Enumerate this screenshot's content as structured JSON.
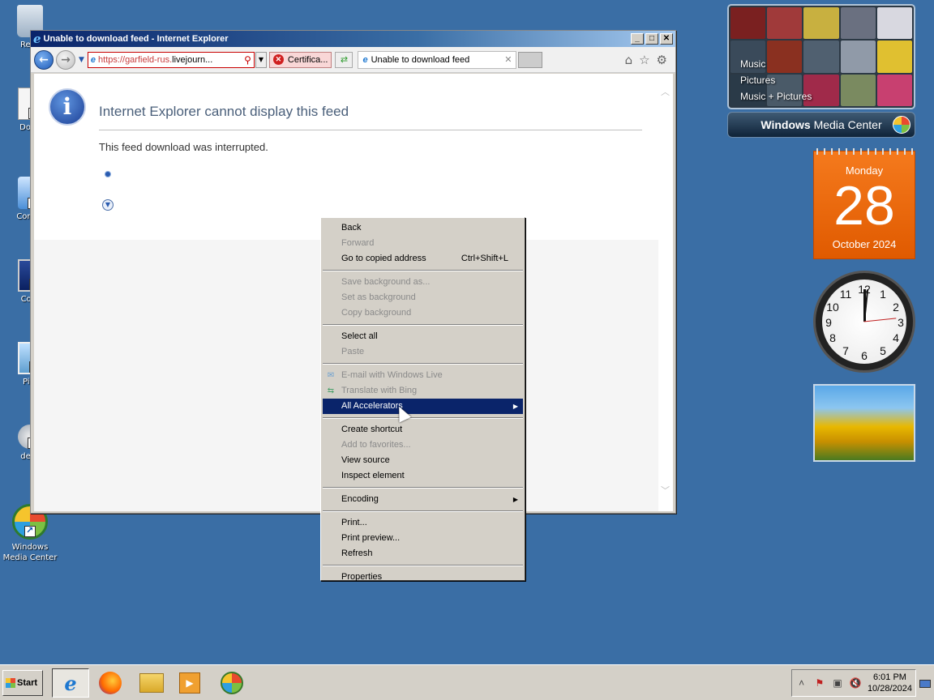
{
  "desktop": {
    "icons": [
      {
        "label": "Recy"
      },
      {
        "label": "Docu"
      },
      {
        "label": "Contro"
      },
      {
        "label": "Com"
      },
      {
        "label": "Pict"
      },
      {
        "label": "desk"
      },
      {
        "label": "Windows Media Center"
      }
    ]
  },
  "ie": {
    "title": "Unable to download feed - Internet Explorer",
    "address_domain": "https://garfield-rus.",
    "address_host": "livejourn...",
    "cert_label": "Certifica...",
    "tab_label": "Unable to download feed",
    "error_title": "Internet Explorer cannot display this feed",
    "error_message": "This feed download was interrupted."
  },
  "context_menu": {
    "items": [
      {
        "label": "Back",
        "disabled": false
      },
      {
        "label": "Forward",
        "disabled": true
      },
      {
        "label": "Go to copied address",
        "shortcut": "Ctrl+Shift+L",
        "disabled": false
      },
      {
        "label": "Save background as...",
        "disabled": true
      },
      {
        "label": "Set as background",
        "disabled": true
      },
      {
        "label": "Copy background",
        "disabled": true
      },
      {
        "label": "Select all",
        "disabled": false
      },
      {
        "label": "Paste",
        "disabled": true
      },
      {
        "label": "E-mail with Windows Live",
        "disabled": true
      },
      {
        "label": "Translate with Bing",
        "disabled": true
      },
      {
        "label": "All Accelerators",
        "disabled": false,
        "highlighted": true
      },
      {
        "label": "Create shortcut",
        "disabled": false
      },
      {
        "label": "Add to favorites...",
        "disabled": true
      },
      {
        "label": "View source",
        "disabled": false
      },
      {
        "label": "Inspect element",
        "disabled": false
      },
      {
        "label": "Encoding",
        "disabled": false
      },
      {
        "label": "Print...",
        "disabled": false
      },
      {
        "label": "Print preview...",
        "disabled": false
      },
      {
        "label": "Refresh",
        "disabled": false
      },
      {
        "label": "Properties",
        "disabled": false
      }
    ]
  },
  "gadgets": {
    "media_center": {
      "menu": [
        "Music",
        "Pictures",
        "Music + Pictures"
      ],
      "brand_bold": "Windows",
      "brand_rest": " Media Center"
    },
    "calendar": {
      "weekday": "Monday",
      "day": "28",
      "month_year": "October 2024"
    },
    "clock": {
      "numbers": [
        "12",
        "1",
        "2",
        "3",
        "4",
        "5",
        "6",
        "7",
        "8",
        "9",
        "10",
        "11"
      ]
    }
  },
  "taskbar": {
    "start_label": "Start",
    "time": "6:01 PM",
    "date": "10/28/2024"
  },
  "colors": {
    "desktop": "#3a6ea5",
    "title_active": "#0a246a",
    "menu_highlight": "#0a246a",
    "calendar": "#f57a1d"
  }
}
